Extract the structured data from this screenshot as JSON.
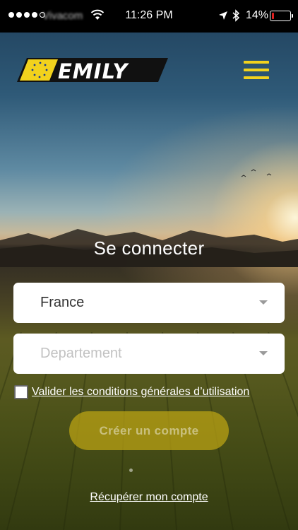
{
  "status_bar": {
    "carrier": "Vivacom",
    "time": "11:26 PM",
    "battery_text": "14%",
    "battery_level": 0.14,
    "signal_bars_filled": 4,
    "signal_bars_total": 5
  },
  "header": {
    "logo_text": "EMILY",
    "brand_color": "#f2d21d"
  },
  "form": {
    "title": "Se connecter",
    "country_select": {
      "value": "France"
    },
    "department_select": {
      "placeholder": "Departement"
    },
    "terms_label": "Valider les conditions générales d’utilisation",
    "terms_checked": false,
    "create_button_label": "Créer un compte",
    "recover_link": "Récupérer mon compte"
  },
  "icons": [
    "wifi-icon",
    "location-arrow-icon",
    "bluetooth-icon",
    "battery-icon",
    "hamburger-menu-icon",
    "chevron-down-icon",
    "eu-stars-icon"
  ]
}
